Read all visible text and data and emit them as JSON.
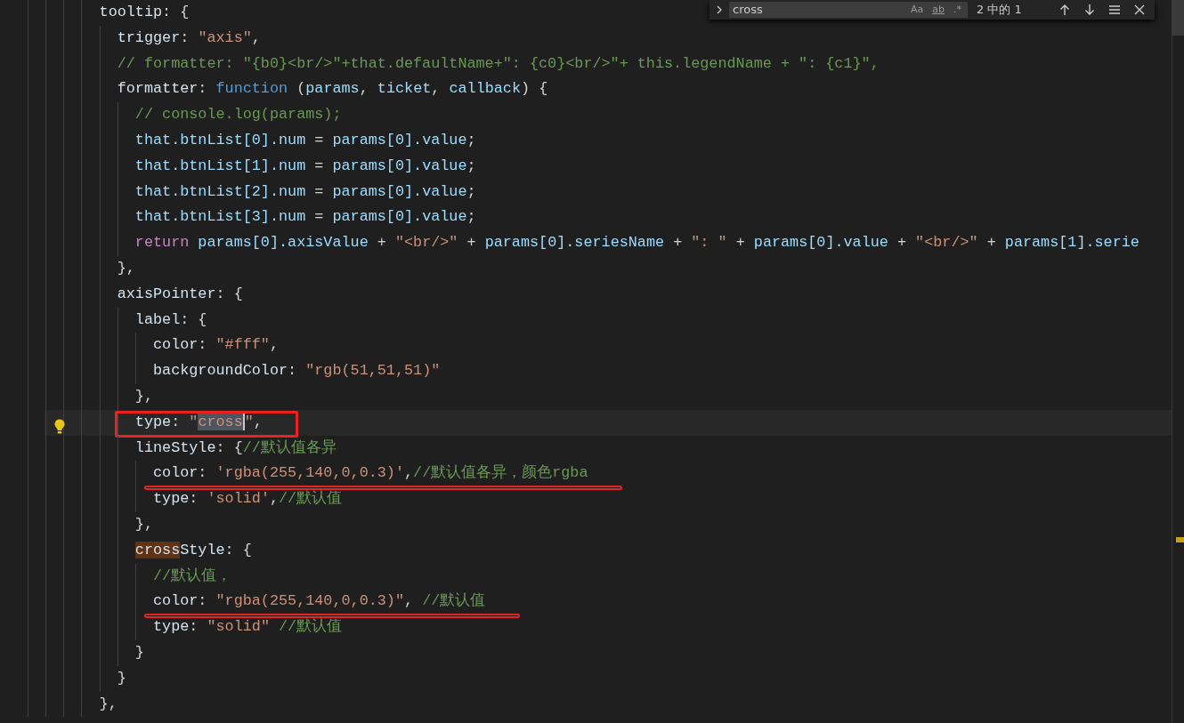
{
  "find_widget": {
    "value": "cross",
    "options": [
      {
        "label": "Aa",
        "on": false
      },
      {
        "label": "ab",
        "on": false
      },
      {
        "label": ".*",
        "on": false
      }
    ],
    "match_count": "2 中的 1"
  },
  "lines": [
    {
      "current": false,
      "tokens": [
        {
          "kind": "key",
          "text": "        tooltip"
        },
        {
          "kind": "punct",
          "text": ": {"
        }
      ]
    },
    {
      "current": false,
      "tokens": [
        {
          "kind": "key",
          "text": "          trigger"
        },
        {
          "kind": "punct",
          "text": ": "
        },
        {
          "kind": "string",
          "text": "\"axis\""
        },
        {
          "kind": "punct",
          "text": ","
        }
      ]
    },
    {
      "current": false,
      "tokens": [
        {
          "kind": "comment",
          "text": "          // formatter: \"{b0}<br/>\"+that.defaultName+\": {c0}<br/>\"+ this.legendName + \": {c1}\","
        }
      ]
    },
    {
      "current": false,
      "tokens": [
        {
          "kind": "key",
          "text": "          formatter"
        },
        {
          "kind": "punct",
          "text": ": "
        },
        {
          "kind": "keyword",
          "text": "function"
        },
        {
          "kind": "punct",
          "text": " ("
        },
        {
          "kind": "var",
          "text": "params"
        },
        {
          "kind": "punct",
          "text": ", "
        },
        {
          "kind": "var",
          "text": "ticket"
        },
        {
          "kind": "punct",
          "text": ", "
        },
        {
          "kind": "var",
          "text": "callback"
        },
        {
          "kind": "punct",
          "text": ") {"
        }
      ]
    },
    {
      "current": false,
      "tokens": [
        {
          "kind": "comment",
          "text": "            // console.log(params);"
        }
      ]
    },
    {
      "current": false,
      "tokens": [
        {
          "kind": "var",
          "text": "            that.btnList[0].num"
        },
        {
          "kind": "punct",
          "text": " = "
        },
        {
          "kind": "var",
          "text": "params[0].value"
        },
        {
          "kind": "punct",
          "text": ";"
        }
      ]
    },
    {
      "current": false,
      "tokens": [
        {
          "kind": "var",
          "text": "            that.btnList[1].num"
        },
        {
          "kind": "punct",
          "text": " = "
        },
        {
          "kind": "var",
          "text": "params[0].value"
        },
        {
          "kind": "punct",
          "text": ";"
        }
      ]
    },
    {
      "current": false,
      "tokens": [
        {
          "kind": "var",
          "text": "            that.btnList[2].num"
        },
        {
          "kind": "punct",
          "text": " = "
        },
        {
          "kind": "var",
          "text": "params[0].value"
        },
        {
          "kind": "punct",
          "text": ";"
        }
      ]
    },
    {
      "current": false,
      "tokens": [
        {
          "kind": "var",
          "text": "            that.btnList[3].num"
        },
        {
          "kind": "punct",
          "text": " = "
        },
        {
          "kind": "var",
          "text": "params[0].value"
        },
        {
          "kind": "punct",
          "text": ";"
        }
      ]
    },
    {
      "current": false,
      "tokens": [
        {
          "kind": "control",
          "text": "            return"
        },
        {
          "kind": "var",
          "text": " params[0].axisValue"
        },
        {
          "kind": "punct",
          "text": " + "
        },
        {
          "kind": "string",
          "text": "\"<br/>\""
        },
        {
          "kind": "punct",
          "text": " + "
        },
        {
          "kind": "var",
          "text": "params[0].seriesName"
        },
        {
          "kind": "punct",
          "text": " + "
        },
        {
          "kind": "string",
          "text": "\": \""
        },
        {
          "kind": "punct",
          "text": " + "
        },
        {
          "kind": "var",
          "text": "params[0].value"
        },
        {
          "kind": "punct",
          "text": " + "
        },
        {
          "kind": "string",
          "text": "\"<br/>\""
        },
        {
          "kind": "punct",
          "text": " + "
        },
        {
          "kind": "var",
          "text": "params[1].serie"
        }
      ]
    },
    {
      "current": false,
      "tokens": [
        {
          "kind": "punct",
          "text": "          },"
        }
      ]
    },
    {
      "current": false,
      "tokens": [
        {
          "kind": "key",
          "text": "          axisPointer"
        },
        {
          "kind": "punct",
          "text": ": {"
        }
      ]
    },
    {
      "current": false,
      "tokens": [
        {
          "kind": "key",
          "text": "            label"
        },
        {
          "kind": "punct",
          "text": ": {"
        }
      ]
    },
    {
      "current": false,
      "tokens": [
        {
          "kind": "key",
          "text": "              color"
        },
        {
          "kind": "punct",
          "text": ": "
        },
        {
          "kind": "string",
          "text": "\"#fff\""
        },
        {
          "kind": "punct",
          "text": ","
        }
      ]
    },
    {
      "current": false,
      "tokens": [
        {
          "kind": "key",
          "text": "              backgroundColor"
        },
        {
          "kind": "punct",
          "text": ": "
        },
        {
          "kind": "string",
          "text": "\"rgb(51,51,51)\""
        }
      ]
    },
    {
      "current": false,
      "tokens": [
        {
          "kind": "punct",
          "text": "            },"
        }
      ]
    },
    {
      "current": true,
      "annotation": {
        "kind": "box"
      },
      "tokens": [
        {
          "kind": "key",
          "text": "            type"
        },
        {
          "kind": "punct",
          "text": ": "
        },
        {
          "kind": "string",
          "text": "\""
        },
        {
          "kind": "string",
          "text": "cross",
          "match": {
            "selected": true
          }
        },
        {
          "kind": "string",
          "text": "\""
        },
        {
          "kind": "punct",
          "text": ","
        }
      ]
    },
    {
      "current": false,
      "tokens": [
        {
          "kind": "key",
          "text": "            lineStyle"
        },
        {
          "kind": "punct",
          "text": ": {"
        },
        {
          "kind": "comment",
          "text": "//默认值各异"
        }
      ]
    },
    {
      "current": false,
      "annotation": {
        "kind": "underline"
      },
      "tokens": [
        {
          "kind": "key",
          "text": "              color"
        },
        {
          "kind": "punct",
          "text": ": "
        },
        {
          "kind": "string",
          "text": "'rgba(255,140,0,0.3)'"
        },
        {
          "kind": "punct",
          "text": ","
        },
        {
          "kind": "comment",
          "text": "//默认值各异，颜色rgba"
        }
      ]
    },
    {
      "current": false,
      "tokens": [
        {
          "kind": "key",
          "text": "              type"
        },
        {
          "kind": "punct",
          "text": ": "
        },
        {
          "kind": "string",
          "text": "'solid'"
        },
        {
          "kind": "punct",
          "text": ","
        },
        {
          "kind": "comment",
          "text": "//默认值"
        }
      ]
    },
    {
      "current": false,
      "tokens": [
        {
          "kind": "punct",
          "text": "            },"
        }
      ]
    },
    {
      "current": false,
      "tokens": [
        {
          "kind": "key",
          "text": "            cross",
          "match": {
            "selected": false
          }
        },
        {
          "kind": "key",
          "text": "Style"
        },
        {
          "kind": "punct",
          "text": ": {"
        }
      ]
    },
    {
      "current": false,
      "tokens": [
        {
          "kind": "comment",
          "text": "              //默认值，"
        }
      ]
    },
    {
      "current": false,
      "annotation": {
        "kind": "underline"
      },
      "tokens": [
        {
          "kind": "key",
          "text": "              color"
        },
        {
          "kind": "punct",
          "text": ": "
        },
        {
          "kind": "string",
          "text": "\"rgba(255,140,0,0.3)\""
        },
        {
          "kind": "punct",
          "text": ", "
        },
        {
          "kind": "comment",
          "text": "//默认值"
        }
      ]
    },
    {
      "current": false,
      "tokens": [
        {
          "kind": "key",
          "text": "              type"
        },
        {
          "kind": "punct",
          "text": ": "
        },
        {
          "kind": "string",
          "text": "\"solid\""
        },
        {
          "kind": "comment",
          "text": " //默认值"
        }
      ]
    },
    {
      "current": false,
      "tokens": [
        {
          "kind": "punct",
          "text": "            }"
        }
      ]
    },
    {
      "current": false,
      "tokens": [
        {
          "kind": "punct",
          "text": "          }"
        }
      ]
    },
    {
      "current": false,
      "tokens": [
        {
          "kind": "punct",
          "text": "        },"
        }
      ]
    }
  ]
}
